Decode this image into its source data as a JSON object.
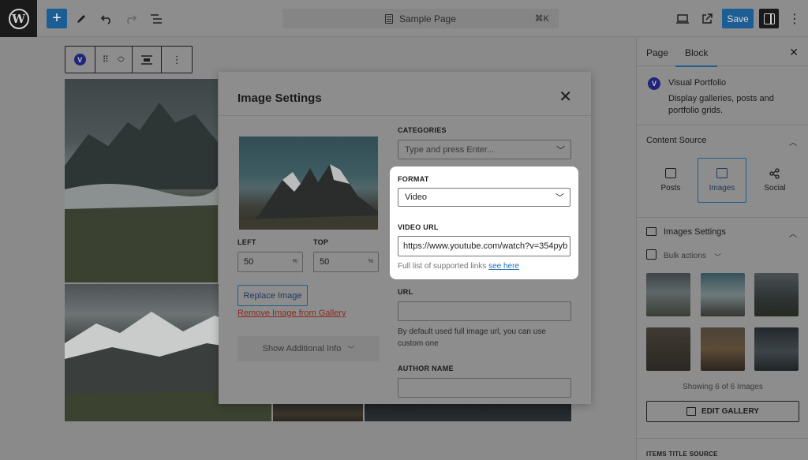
{
  "topbar": {
    "doc_title": "Sample Page",
    "shortcut": "⌘K",
    "save_label": "Save"
  },
  "sidebar": {
    "tabs": [
      {
        "label": "Page"
      },
      {
        "label": "Block"
      }
    ],
    "plugin_name": "Visual Portfolio",
    "plugin_description": "Display galleries, posts and portfolio grids.",
    "content_source_title": "Content Source",
    "source_options": [
      {
        "label": "Posts"
      },
      {
        "label": "Images"
      },
      {
        "label": "Social"
      }
    ],
    "images_settings_title": "Images Settings",
    "bulk_actions_label": "Bulk actions",
    "showing_text": "Showing 6 of 6 Images",
    "edit_gallery_label": "EDIT GALLERY",
    "items_title_source": "ITEMS TITLE SOURCE"
  },
  "modal": {
    "title": "Image Settings",
    "left_label": "LEFT",
    "left_value": "50",
    "top_label": "TOP",
    "top_value": "50",
    "unit": "%",
    "replace_label": "Replace Image",
    "remove_label": "Remove Image from Gallery",
    "show_info_label": "Show Additional Info",
    "categories_label": "CATEGORIES",
    "categories_placeholder": "Type and press Enter...",
    "format_label": "FORMAT",
    "format_value": "Video",
    "video_url_label": "VIDEO URL",
    "video_url_value": "https://www.youtube.com/watch?v=354pyb",
    "supported_text": "Full list of supported links ",
    "see_here": "see here",
    "url_label": "URL",
    "url_help": "By default used full image url, you can use custom one",
    "author_label": "AUTHOR NAME"
  },
  "colors": {
    "accent": "#1c5e94",
    "link": "#2271b1",
    "danger_link": "#8a2a1f"
  }
}
